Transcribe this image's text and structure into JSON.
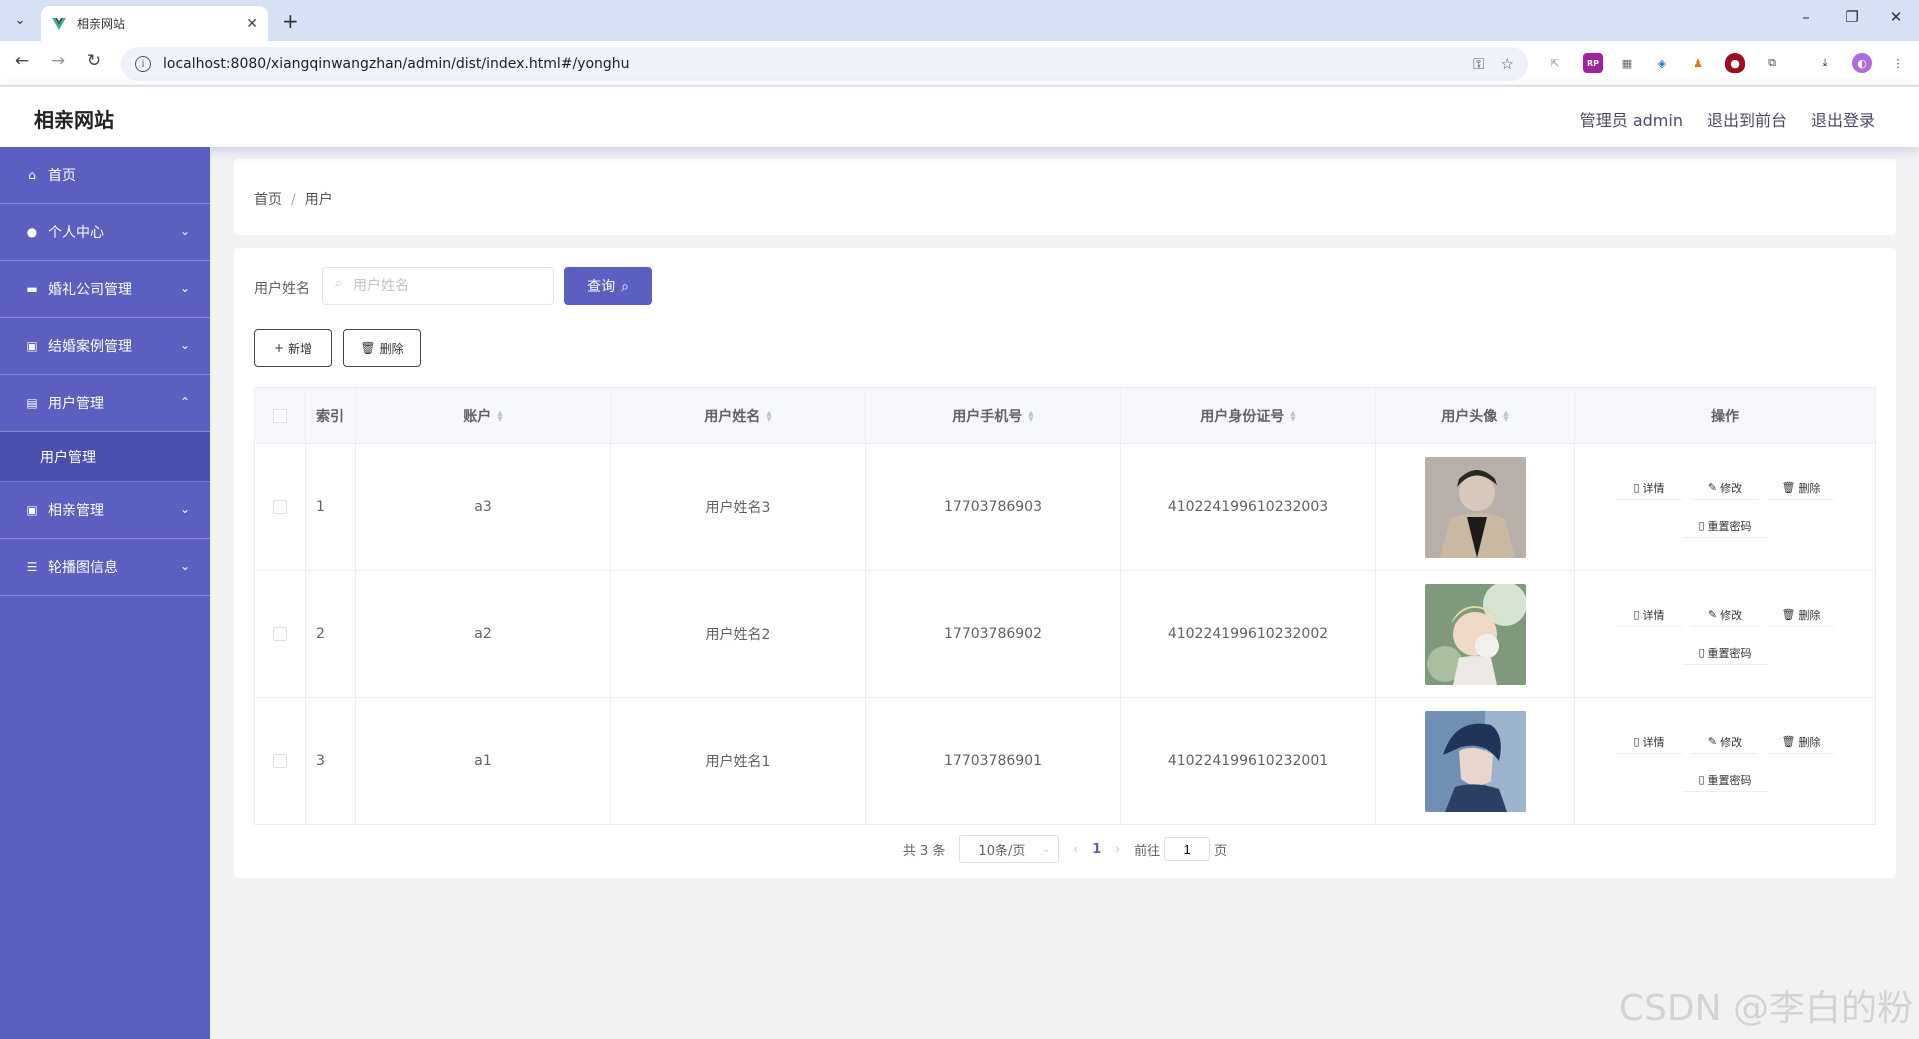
{
  "browser": {
    "tab_title": "相亲网站",
    "url": "localhost:8080/xiangqinwangzhan/admin/dist/index.html#/yonghu",
    "extension_rp_label": "RP"
  },
  "header": {
    "app_title": "相亲网站",
    "admin_label": "管理员 admin",
    "frontend_link": "退出到前台",
    "logout_link": "退出登录"
  },
  "sidebar": {
    "items": [
      {
        "label": "首页"
      },
      {
        "label": "个人中心"
      },
      {
        "label": "婚礼公司管理"
      },
      {
        "label": "结婚案例管理"
      },
      {
        "label": "用户管理"
      },
      {
        "label": "用户管理"
      },
      {
        "label": "相亲管理"
      },
      {
        "label": "轮播图信息"
      }
    ]
  },
  "breadcrumb": {
    "home": "首页",
    "sep": "/",
    "current": "用户"
  },
  "search": {
    "label": "用户姓名",
    "placeholder": "用户姓名",
    "query_button": "查询"
  },
  "actions": {
    "add_button": "新增",
    "delete_button": "删除"
  },
  "table": {
    "headers": {
      "index": "索引",
      "account": "账户",
      "name": "用户姓名",
      "phone": "用户手机号",
      "idcard": "用户身份证号",
      "avatar": "用户头像",
      "ops": "操作"
    },
    "rows": [
      {
        "index": "1",
        "account": "a3",
        "name": "用户姓名3",
        "phone": "17703786903",
        "idcard": "410224199610232003"
      },
      {
        "index": "2",
        "account": "a2",
        "name": "用户姓名2",
        "phone": "17703786902",
        "idcard": "410224199610232002"
      },
      {
        "index": "3",
        "account": "a1",
        "name": "用户姓名1",
        "phone": "17703786901",
        "idcard": "410224199610232001"
      }
    ],
    "row_actions": {
      "detail": "详情",
      "edit": "修改",
      "delete": "删除",
      "reset_password": "重置密码"
    }
  },
  "pagination": {
    "total_text": "共 3 条",
    "page_size": "10条/页",
    "current_page": "1",
    "goto_prefix": "前往",
    "goto_value": "1",
    "goto_suffix": "页"
  },
  "watermark": "CSDN @李白的粉",
  "colors": {
    "accent": "#5b5fbf",
    "sidebar_bg": "#5b5fbf",
    "page_bg": "#f2f2f5"
  }
}
